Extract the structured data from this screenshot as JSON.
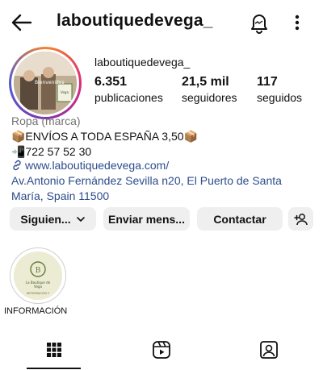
{
  "header": {
    "title": "laboutiquedevega_",
    "icons": [
      "back-arrow-icon",
      "bell-icon",
      "more-vertical-icon"
    ]
  },
  "profile": {
    "username": "laboutiquedevega_",
    "avatar_text": "Bienvenidos",
    "stats": [
      {
        "value": "6.351",
        "label": "publicaciones"
      },
      {
        "value": "21,5 mil",
        "label": "seguidores"
      },
      {
        "value": "117",
        "label": "seguidos"
      }
    ],
    "category": "Ropa (marca)",
    "bio_line1": "📦ENVÍOS A TODA ESPAÑA 3,50📦",
    "bio_line2": "📲722 57 52 30",
    "link": "www.laboutiquedevega.com/",
    "address": "Av.Antonio Fernández Sevilla n20, El Puerto de Santa María, Spain 11500"
  },
  "actions": {
    "following": "Siguien...",
    "message": "Enviar mens...",
    "contact": "Contactar"
  },
  "highlight": {
    "label": "INFORMACIÓN",
    "image_text": "INFORMACIÓN Y"
  },
  "tabs": [
    "grid-icon",
    "reels-icon",
    "tagged-icon"
  ],
  "colors": {
    "link": "#2d4c8a",
    "button_bg": "#efefef",
    "muted": "#737373"
  }
}
